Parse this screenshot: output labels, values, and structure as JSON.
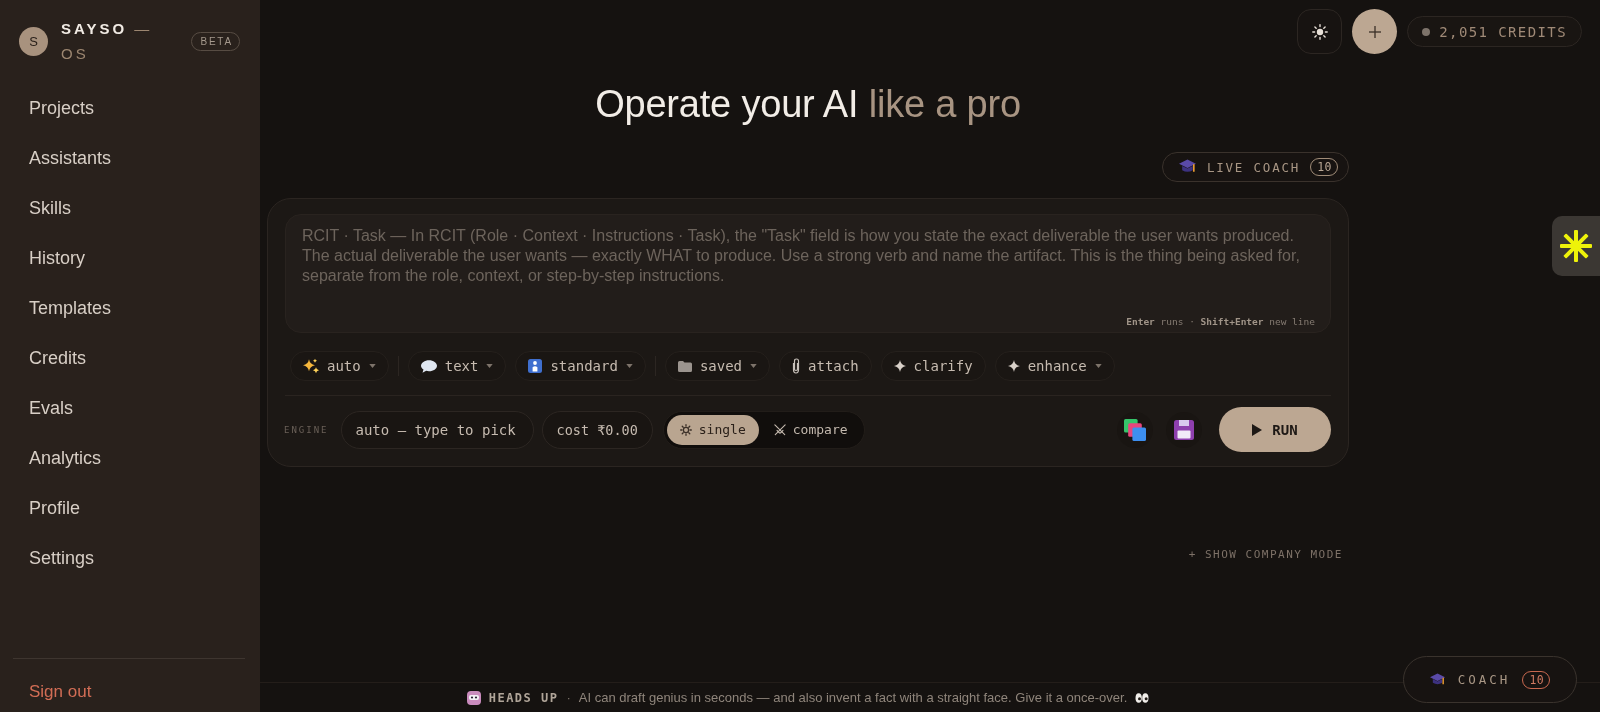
{
  "sidebar": {
    "avatar_letter": "S",
    "brand_name": "SAYSO",
    "brand_suffix": "— OS",
    "badge": "BETA",
    "items": [
      {
        "label": "Projects",
        "selected": false
      },
      {
        "label": "Assistants",
        "selected": false
      },
      {
        "label": "Skills",
        "selected": false
      },
      {
        "label": "History",
        "selected": false
      },
      {
        "label": "Templates",
        "selected": false
      },
      {
        "label": "Credits",
        "selected": false
      },
      {
        "label": "Evals",
        "selected": false
      },
      {
        "label": "Analytics",
        "selected": false
      },
      {
        "label": "Profile",
        "selected": false
      },
      {
        "label": "Settings",
        "selected": false
      }
    ],
    "sign_out": "Sign out"
  },
  "topbar": {
    "credits": "2,051 CREDITS"
  },
  "title": {
    "lead": "Operate your AI",
    "accent": "like a pro"
  },
  "live_coach": {
    "label": "LIVE COACH",
    "count": "10"
  },
  "prompt": {
    "placeholder": "RCIT · Task — In RCIT (Role · Context · Instructions · Task), the \"Task\" field is how you state the exact deliverable the user wants produced. The actual deliverable the user wants — exactly WHAT to produce. Use a strong verb and name the artifact. This is the thing being asked for, separate from the role, context, or step-by-step instructions.",
    "hint": "**Enter** runs · **Shift+Enter** new line"
  },
  "option_groups": [
    {
      "items": [
        {
          "label": "auto",
          "dropdown": true
        }
      ]
    },
    {
      "items": [
        {
          "label": "text",
          "dropdown": true
        },
        {
          "label": "standard",
          "dropdown": true
        }
      ]
    },
    {
      "items": [
        {
          "label": "saved",
          "dropdown": true
        },
        {
          "label": "attach",
          "dropdown": false
        },
        {
          "label": "clarify",
          "dropdown": false
        },
        {
          "label": "enhance",
          "dropdown": true
        }
      ]
    }
  ],
  "engine": {
    "label": "ENGINE",
    "model_field": {
      "placeholder": "auto — type to pick"
    },
    "cost": "cost ₹0.00",
    "modes": [
      {
        "label": "single",
        "selected": true
      },
      {
        "label": "compare",
        "selected": false
      }
    ],
    "run": "RUN"
  },
  "company_mode": "+ SHOW COMPANY MODE",
  "banner": {
    "label": "HEADS UP",
    "separator": "·",
    "message": "AI can draft genius in seconds — and also invent a fact with a straight face. Give it a once-over."
  },
  "coach": {
    "label": "COACH",
    "count": "10"
  }
}
